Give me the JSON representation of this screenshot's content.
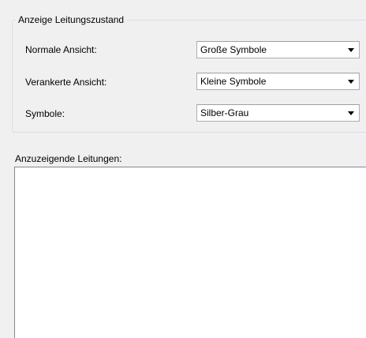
{
  "group": {
    "title": "Anzeige Leitungszustand",
    "rows": [
      {
        "label": "Normale Ansicht:",
        "value": "Große Symbole"
      },
      {
        "label": "Verankerte Ansicht:",
        "value": "Kleine Symbole"
      },
      {
        "label": "Symbole:",
        "value": "Silber-Grau"
      }
    ]
  },
  "lines": {
    "label": "Anzuzeigende Leitungen:",
    "items": []
  }
}
